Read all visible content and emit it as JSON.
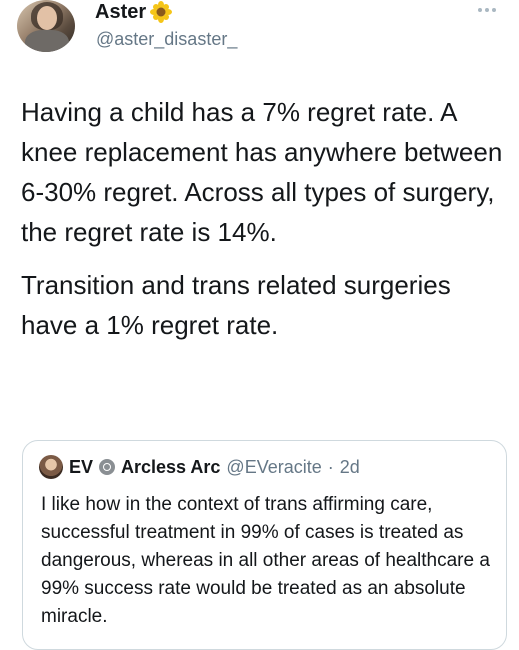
{
  "author": {
    "display_name": "Aster",
    "name_emoji_icon": "sunflower-icon",
    "handle": "@aster_disaster_"
  },
  "tweet": {
    "paragraph_1": "Having a child has a 7% regret rate. A knee replacement has anywhere between 6-30% regret. Across all types of surgery, the regret rate is 14%.",
    "paragraph_2": "Transition and trans related surgeries have a 1% regret rate."
  },
  "quoted_tweet": {
    "display_name_prefix": "EV",
    "badge_icon": "circle-badge-icon",
    "display_name": "Arcless Arc",
    "handle": "@EVeracite",
    "separator": "·",
    "time": "2d",
    "text": "I like how in the context of trans affirming care, successful treatment in 99% of cases is treated as dangerous, whereas in all other areas of healthcare a 99% success rate would be treated as an absolute miracle."
  },
  "colors": {
    "text": "#14171a",
    "secondary_text": "#657786",
    "border": "#cfd9de"
  }
}
